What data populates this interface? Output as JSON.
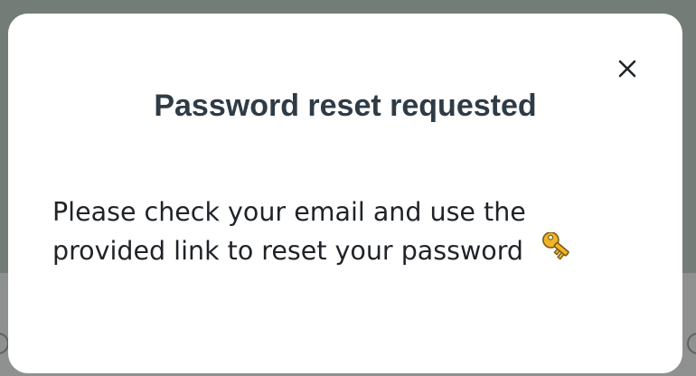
{
  "dialog": {
    "title": "Password reset requested",
    "message_line1": "Please check your email and use the",
    "message_line2": "provided link to reset your password",
    "close_icon": "close-icon",
    "message_icon": "key-icon"
  },
  "colors": {
    "backdrop": "#737c76",
    "backdrop_lower": "#8e918f",
    "dialog_background": "#ffffff",
    "title": "#2f3b45",
    "body_text": "#1f2328",
    "key_gold": "#f0b429"
  }
}
